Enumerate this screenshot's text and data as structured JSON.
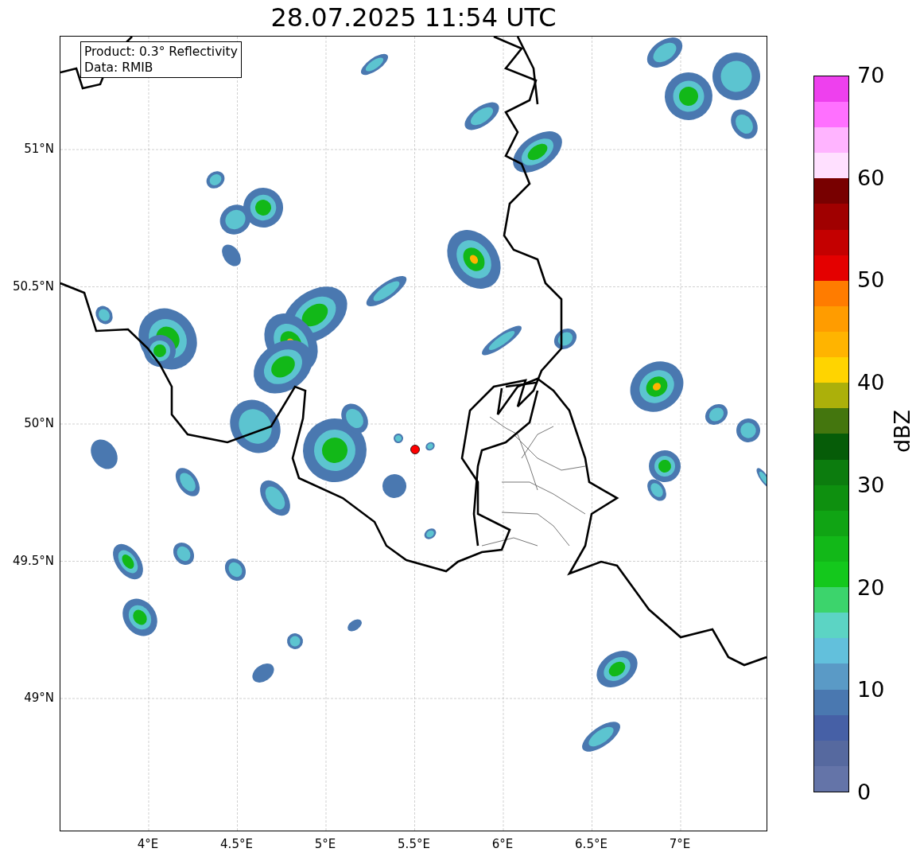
{
  "title": "28.07.2025 11:54 UTC",
  "info_box": {
    "lines": [
      "Product: 0.3° Reflectivity",
      "Data: RMIB"
    ]
  },
  "map": {
    "x_ticks": [
      "4°E",
      "4.5°E",
      "5°E",
      "5.5°E",
      "6°E",
      "6.5°E",
      "7°E"
    ],
    "y_ticks": [
      "51°N",
      "50.5°N",
      "50°N",
      "49.5°N",
      "49°N"
    ]
  },
  "colorbar": {
    "label": "dBZ",
    "ticks": [
      "70",
      "60",
      "50",
      "40",
      "30",
      "20",
      "10",
      "0"
    ],
    "bands": [
      {
        "color": "#6474a8"
      },
      {
        "color": "#56699f"
      },
      {
        "color": "#4660a6"
      },
      {
        "color": "#4a78b0"
      },
      {
        "color": "#5a9ac6"
      },
      {
        "color": "#62c0dc"
      },
      {
        "color": "#5cd4c4"
      },
      {
        "color": "#3cd46c"
      },
      {
        "color": "#14c81c"
      },
      {
        "color": "#12b818"
      },
      {
        "color": "#10a414"
      },
      {
        "color": "#0e900f"
      },
      {
        "color": "#0c7c0e"
      },
      {
        "color": "#065c08"
      },
      {
        "color": "#44760e"
      },
      {
        "color": "#acb00a"
      },
      {
        "color": "#ffd400"
      },
      {
        "color": "#ffb400"
      },
      {
        "color": "#ff9c00"
      },
      {
        "color": "#ff7c00"
      },
      {
        "color": "#e40000"
      },
      {
        "color": "#c40000"
      },
      {
        "color": "#a00000"
      },
      {
        "color": "#780000"
      },
      {
        "color": "#ffe0ff"
      },
      {
        "color": "#ffb4ff"
      },
      {
        "color": "#ff70ff"
      },
      {
        "color": "#ee40ee"
      }
    ]
  }
}
